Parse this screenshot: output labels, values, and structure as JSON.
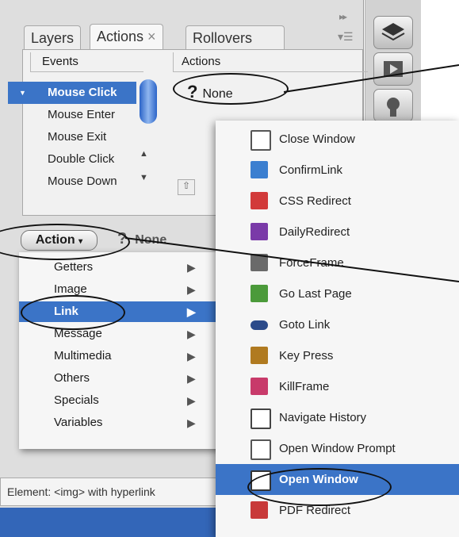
{
  "tabs": [
    "Layers",
    "Actions",
    "Rollovers"
  ],
  "tab_close_glyph": "×",
  "events": {
    "header": "Events",
    "items": [
      "Mouse Click",
      "Mouse Enter",
      "Mouse Exit",
      "Double Click",
      "Mouse Down"
    ],
    "selected_index": 0
  },
  "actions": {
    "header": "Actions",
    "current": "None",
    "question_glyph": "?"
  },
  "lower": {
    "action_button": "Action",
    "none_label": "None"
  },
  "action_menu": {
    "items": [
      "Getters",
      "Image",
      "Link",
      "Message",
      "Multimedia",
      "Others",
      "Specials",
      "Variables"
    ],
    "selected": "Link",
    "arrow_glyph": "▶"
  },
  "link_menu": {
    "items": [
      {
        "label": "Close Window",
        "icon": "window-close-icon",
        "color": "#9a9a9a"
      },
      {
        "label": "ConfirmLink",
        "icon": "confirm-link-icon",
        "color": "#3b7fd0"
      },
      {
        "label": "CSS Redirect",
        "icon": "css-redirect-icon",
        "color": "#d23a3a"
      },
      {
        "label": "DailyRedirect",
        "icon": "daily-redirect-icon",
        "color": "#7a3aa8"
      },
      {
        "label": "ForceFrame",
        "icon": "force-frame-icon",
        "color": "#6a6a6a"
      },
      {
        "label": "Go Last Page",
        "icon": "go-last-page-icon",
        "color": "#4b9a3a"
      },
      {
        "label": "Goto Link",
        "icon": "goto-link-icon",
        "color": "#2b4a8a"
      },
      {
        "label": "Key Press",
        "icon": "key-press-icon",
        "color": "#b07a20"
      },
      {
        "label": "KillFrame",
        "icon": "kill-frame-icon",
        "color": "#c83a6a"
      },
      {
        "label": "Navigate History",
        "icon": "navigate-history-icon",
        "color": "#555555"
      },
      {
        "label": "Open Window Prompt",
        "icon": "open-window-prompt-icon",
        "color": "#777777"
      },
      {
        "label": "Open Window",
        "icon": "open-window-icon",
        "color": "#888888"
      },
      {
        "label": "PDF Redirect",
        "icon": "pdf-redirect-icon",
        "color": "#c83a3a"
      }
    ],
    "selected": "Open Window"
  },
  "status": {
    "text": "Element: <img> with hyperlink"
  },
  "colors": {
    "selection": "#3b74c7",
    "panel_bg": "#dedede"
  }
}
